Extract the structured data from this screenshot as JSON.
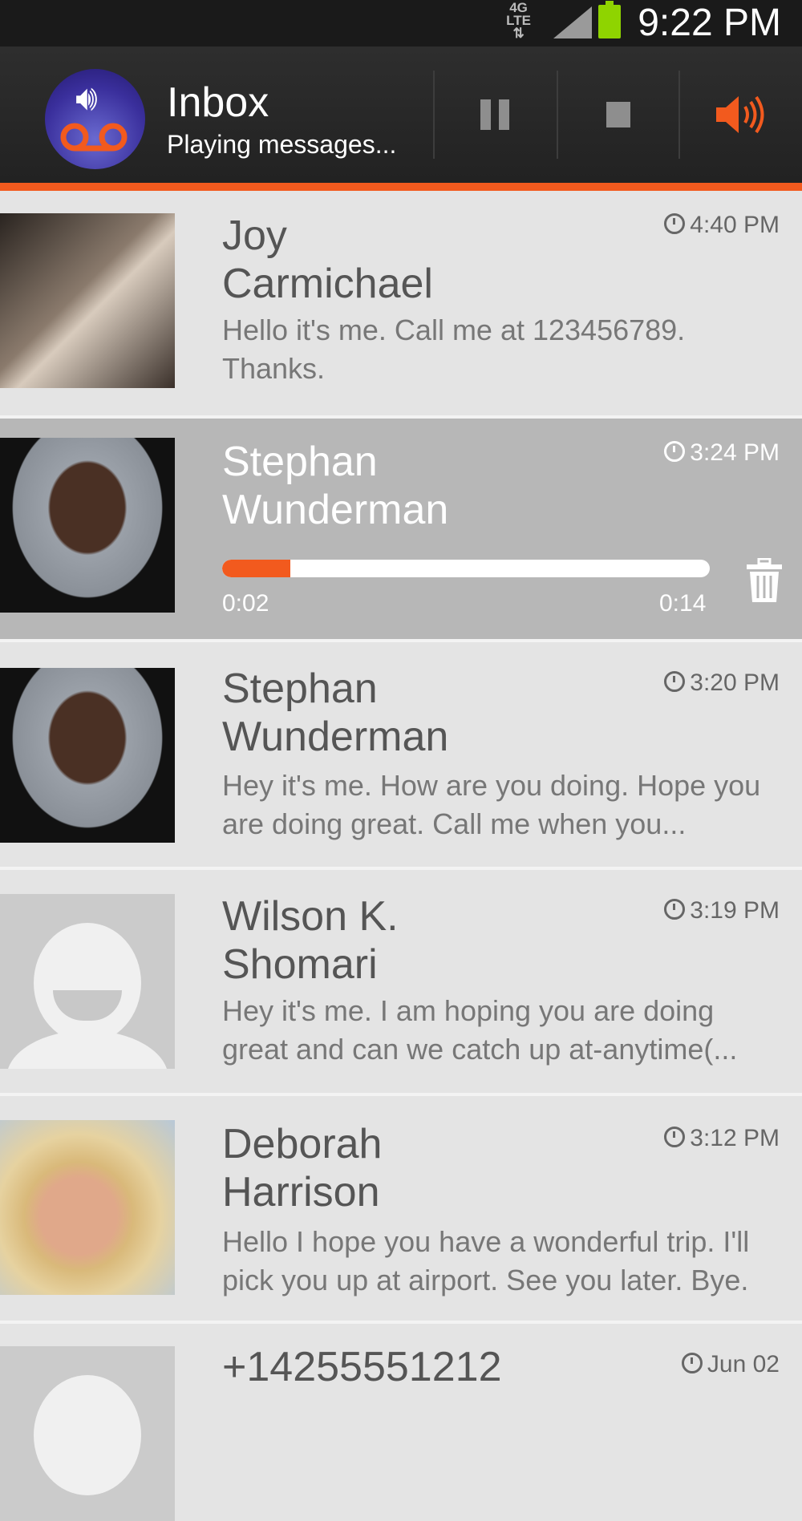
{
  "status_bar": {
    "network": "4G LTE",
    "time": "9:22 PM",
    "icons": [
      "network-4g-lte-icon",
      "signal-icon",
      "battery-icon"
    ]
  },
  "header": {
    "app_icon": "visual-voicemail-icon",
    "title": "Inbox",
    "subtitle": "Playing messages...",
    "buttons": [
      {
        "name": "pause",
        "icon": "pause-icon"
      },
      {
        "name": "stop",
        "icon": "stop-icon"
      },
      {
        "name": "speaker",
        "icon": "speaker-icon",
        "color": "#f25a1e"
      }
    ]
  },
  "accent_color": "#f25a1e",
  "messages": [
    {
      "name_line1": "Joy",
      "name_line2": "Carmichael",
      "time": "4:40 PM",
      "preview": "Hello it's me. Call me at 123456789. Thanks.",
      "avatar": "photo"
    },
    {
      "name_line1": "Stephan",
      "name_line2": "Wunderman",
      "time": "3:24 PM",
      "selected": true,
      "playing": true,
      "elapsed": "0:02",
      "duration": "0:14",
      "progress_fraction": 0.14,
      "avatar": "photo"
    },
    {
      "name_line1": "Stephan",
      "name_line2": "Wunderman",
      "time": "3:20 PM",
      "preview": "Hey it's me. How are you doing. Hope you are doing great. Call me when you...",
      "avatar": "photo"
    },
    {
      "name_line1": "Wilson K.",
      "name_line2": "Shomari",
      "time": "3:19 PM",
      "preview": "Hey it's me. I am hoping you are doing great and can we catch up at-anytime(...",
      "avatar": "placeholder"
    },
    {
      "name_line1": "Deborah",
      "name_line2": "Harrison",
      "time": "3:12 PM",
      "preview": "Hello I hope you have a wonderful trip. I'll pick you up at airport. See you later. Bye.",
      "avatar": "photo"
    },
    {
      "name_line1": "+14255551212",
      "time": "Jun 02",
      "avatar": "placeholder"
    }
  ]
}
